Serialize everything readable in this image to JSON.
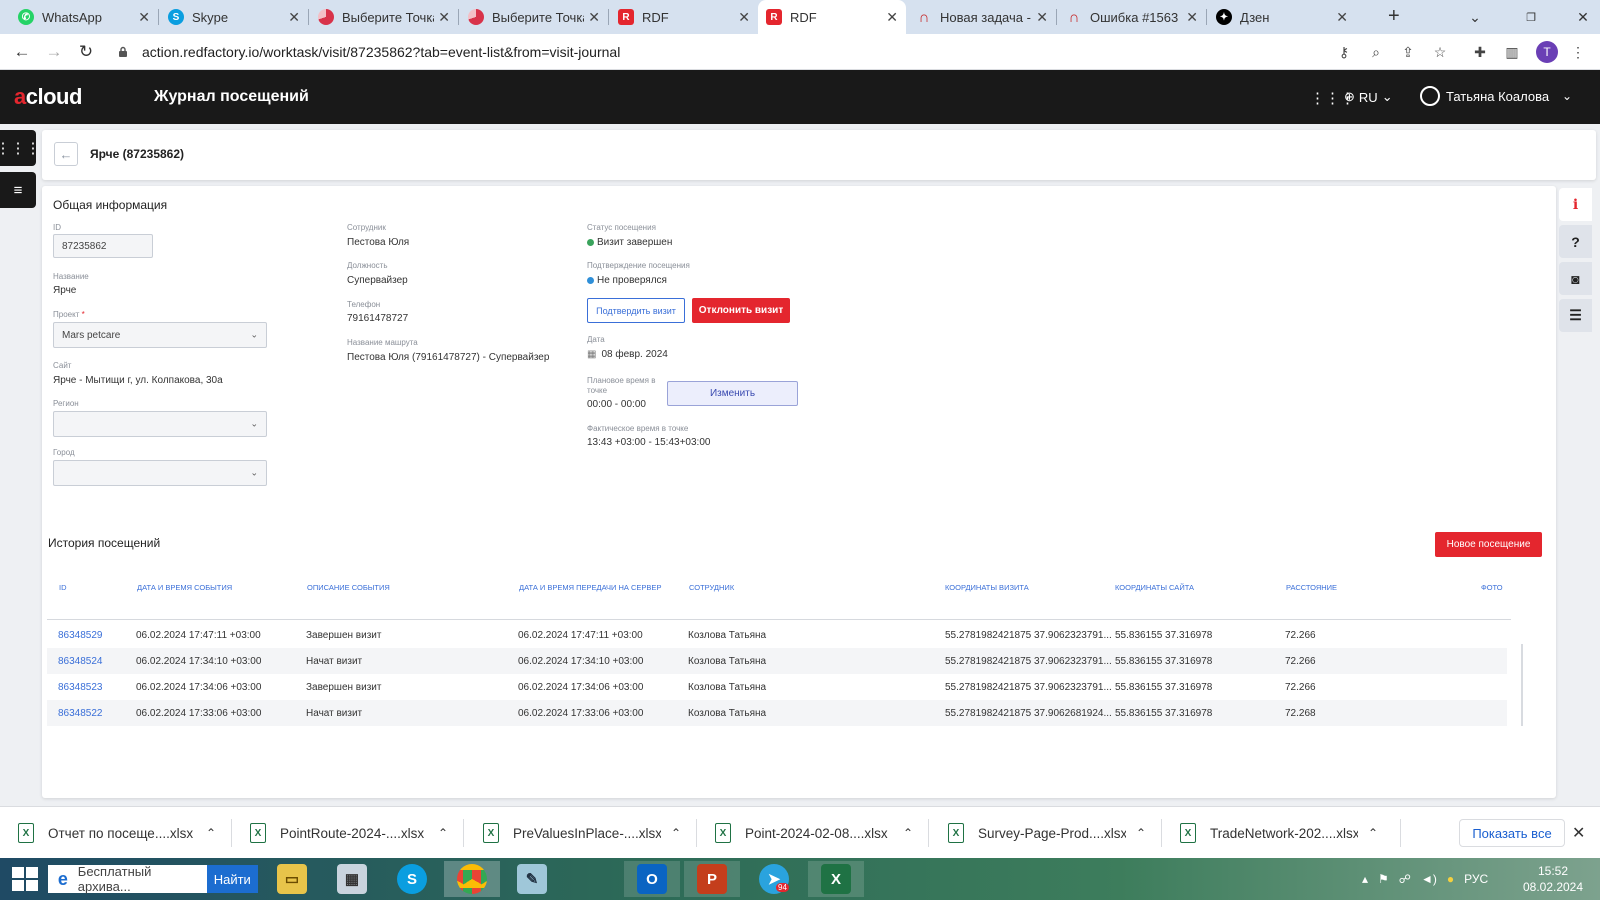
{
  "browser": {
    "tabs": [
      {
        "title": "WhatsApp",
        "icon": "whatsapp-icon",
        "color": "#25d366"
      },
      {
        "title": "Skype",
        "icon": "skype-icon",
        "color": "#0a9ee0"
      },
      {
        "title": "Выберите Точка",
        "icon": "pie-icon",
        "color": "#d8334a"
      },
      {
        "title": "Выберите Точка",
        "icon": "pie-icon",
        "color": "#d8334a"
      },
      {
        "title": "RDF",
        "icon": "rdf-icon",
        "color": "#e4262e"
      },
      {
        "title": "RDF",
        "icon": "rdf-icon",
        "color": "#e4262e",
        "active": true
      },
      {
        "title": "Новая задача -",
        "icon": "redmine-icon",
        "color": "#c62828"
      },
      {
        "title": "Ошибка #1563",
        "icon": "redmine-icon",
        "color": "#c62828"
      },
      {
        "title": "Дзен",
        "icon": "dzen-icon",
        "color": "#000000"
      }
    ],
    "url": "action.redfactory.io/worktask/visit/87235862?tab=event-list&from=visit-journal",
    "profile_initial": "T"
  },
  "app": {
    "logo": {
      "prefix": "a",
      "rest": "cloud"
    },
    "title": "Журнал посещений",
    "lang": "RU",
    "user": "Татьяна Коалова",
    "accent": "#e4262e"
  },
  "page": {
    "title": "Ярче (87235862)"
  },
  "general": {
    "section_title": "Общая информация",
    "id_label": "ID",
    "id_value": "87235862",
    "name_label": "Название",
    "name_value": "Ярче",
    "project_label": "Проект",
    "project_required": "*",
    "project_value": "Mars petcare",
    "site_label": "Сайт",
    "site_value": "Ярче - Мытищи г, ул. Колпакова, 30а",
    "region_label": "Регион",
    "region_value": "",
    "city_label": "Город",
    "city_value": "",
    "employee_label": "Сотрудник",
    "employee_value": "Пестова Юля",
    "position_label": "Должность",
    "position_value": "Супервайзер",
    "phone_label": "Телефон",
    "phone_value": "79161478727",
    "route_label": "Название машрута",
    "route_value": "Пестова Юля (79161478727) - Супервайзер",
    "status_label": "Статус посещения",
    "status_value": "Визит завершен",
    "status_color": "#3aa35c",
    "confirm_label": "Подтверждение посещения",
    "confirm_value": "Не проверялся",
    "confirm_color": "#2f8fd8",
    "confirm_button": "Подтвердить визит",
    "reject_button": "Отклонить визит",
    "date_label": "Дата",
    "date_value": "08 февр. 2024",
    "planned_label": "Плановое время в точке",
    "planned_value": "00:00 - 00:00",
    "change_button": "Изменить",
    "actual_label": "Фактическое время в точке",
    "actual_value": "13:43 +03:00 - 15:43+03:00"
  },
  "history": {
    "section_title": "История посещений",
    "new_button": "Новое посещение",
    "columns": [
      "ID",
      "Дата и время события",
      "Описание события",
      "Дата и время передачи на сервер",
      "Сотрудник",
      "Координаты визита",
      "Координаты сайта",
      "Расстояние",
      "Фото"
    ],
    "rows": [
      {
        "id": "86348529",
        "event_time": "06.02.2024 17:47:11 +03:00",
        "description": "Завершен визит",
        "server_time": "06.02.2024 17:47:11 +03:00",
        "employee": "Козлова Татьяна",
        "visit_coords": "55.2781982421875 37.9062323791...",
        "site_coords": "55.836155 37.316978",
        "distance": "72.266",
        "photo": ""
      },
      {
        "id": "86348524",
        "event_time": "06.02.2024 17:34:10 +03:00",
        "description": "Начат визит",
        "server_time": "06.02.2024 17:34:10 +03:00",
        "employee": "Козлова Татьяна",
        "visit_coords": "55.2781982421875 37.9062323791...",
        "site_coords": "55.836155 37.316978",
        "distance": "72.266",
        "photo": ""
      },
      {
        "id": "86348523",
        "event_time": "06.02.2024 17:34:06 +03:00",
        "description": "Завершен визит",
        "server_time": "06.02.2024 17:34:06 +03:00",
        "employee": "Козлова Татьяна",
        "visit_coords": "55.2781982421875 37.9062323791...",
        "site_coords": "55.836155 37.316978",
        "distance": "72.266",
        "photo": ""
      },
      {
        "id": "86348522",
        "event_time": "06.02.2024 17:33:06 +03:00",
        "description": "Начат визит",
        "server_time": "06.02.2024 17:33:06 +03:00",
        "employee": "Козлова Татьяна",
        "visit_coords": "55.2781982421875 37.9062681924...",
        "site_coords": "55.836155 37.316978",
        "distance": "72.268",
        "photo": ""
      }
    ]
  },
  "downloads": {
    "items": [
      "Отчет по посеще....xlsx",
      "PointRoute-2024-....xlsx",
      "PreValuesInPlace-....xlsx",
      "Point-2024-02-08....xlsx",
      "Survey-Page-Prod....xlsx",
      "TradeNetwork-202....xlsx"
    ],
    "show_all": "Показать все"
  },
  "taskbar": {
    "search_text": "Бесплатный архива...",
    "search_button": "Найти",
    "telegram_badge": "94",
    "lang": "РУС",
    "time": "15:52",
    "date": "08.02.2024"
  }
}
